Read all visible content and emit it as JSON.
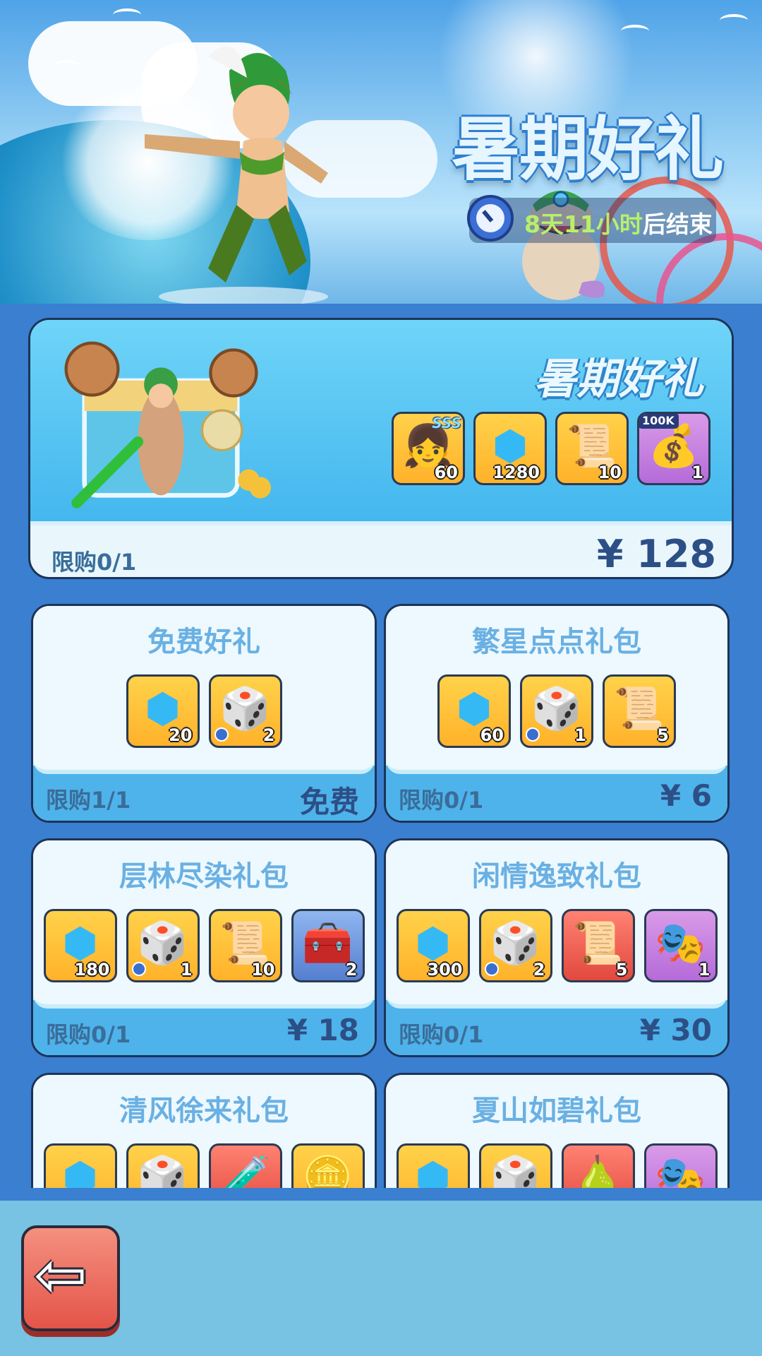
{
  "banner": {
    "title": "暑期好礼",
    "timer_highlight": "8天11小时",
    "timer_suffix": "后结束"
  },
  "featured": {
    "title": "暑期好礼",
    "limit": "限购0/1",
    "price": "¥ 128",
    "items": [
      {
        "icon": "hero-portrait-icon",
        "glyph": "👧",
        "badge": "SSS",
        "qty": "60",
        "bg": "gold"
      },
      {
        "icon": "gem-icon",
        "glyph": "⬢",
        "qty": "1280",
        "bg": "gold"
      },
      {
        "icon": "scroll-icon",
        "glyph": "📜",
        "qty": "10",
        "bg": "gold"
      },
      {
        "icon": "coin-bag-icon",
        "glyph": "💰",
        "tag": "100K",
        "qty": "1",
        "bg": "purple"
      }
    ]
  },
  "packs": [
    {
      "title": "免费好礼",
      "limit": "限购1/1",
      "price": "免费",
      "items": [
        {
          "icon": "gem-icon",
          "glyph": "⬢",
          "qty": "20",
          "bg": "gold"
        },
        {
          "icon": "dice-icon",
          "glyph": "🎲",
          "qty": "2",
          "bg": "gold",
          "timed": true
        }
      ]
    },
    {
      "title": "繁星点点礼包",
      "limit": "限购0/1",
      "price": "¥ 6",
      "items": [
        {
          "icon": "gem-icon",
          "glyph": "⬢",
          "qty": "60",
          "bg": "gold"
        },
        {
          "icon": "dice-icon",
          "glyph": "🎲",
          "qty": "1",
          "bg": "gold",
          "timed": true
        },
        {
          "icon": "scroll-icon",
          "glyph": "📜",
          "qty": "5",
          "bg": "gold"
        }
      ]
    },
    {
      "title": "层林尽染礼包",
      "limit": "限购0/1",
      "price": "¥ 18",
      "items": [
        {
          "icon": "gem-icon",
          "glyph": "⬢",
          "qty": "180",
          "bg": "gold"
        },
        {
          "icon": "dice-icon",
          "glyph": "🎲",
          "qty": "1",
          "bg": "gold",
          "timed": true
        },
        {
          "icon": "scroll-icon",
          "glyph": "📜",
          "qty": "10",
          "bg": "gold"
        },
        {
          "icon": "treasure-chest-icon",
          "glyph": "🧰",
          "qty": "2",
          "bg": "blue"
        }
      ]
    },
    {
      "title": "闲情逸致礼包",
      "limit": "限购0/1",
      "price": "¥ 30",
      "items": [
        {
          "icon": "gem-icon",
          "glyph": "⬢",
          "qty": "300",
          "bg": "gold"
        },
        {
          "icon": "dice-icon",
          "glyph": "🎲",
          "qty": "2",
          "bg": "gold",
          "timed": true
        },
        {
          "icon": "purple-scroll-icon",
          "glyph": "📜",
          "qty": "5",
          "bg": "red"
        },
        {
          "icon": "mask-chest-icon",
          "glyph": "🎭",
          "qty": "1",
          "bg": "purple"
        }
      ]
    },
    {
      "title": "清风徐来礼包",
      "limit": "",
      "price": "",
      "items": [
        {
          "icon": "gem-icon",
          "glyph": "⬢",
          "qty": "",
          "bg": "gold"
        },
        {
          "icon": "dice-icon",
          "glyph": "🎲",
          "qty": "",
          "bg": "gold"
        },
        {
          "icon": "potion-icon",
          "glyph": "🧪",
          "qty": "",
          "bg": "red"
        },
        {
          "icon": "coin-icon",
          "glyph": "🪙",
          "qty": "",
          "bg": "gold"
        }
      ]
    },
    {
      "title": "夏山如碧礼包",
      "limit": "",
      "price": "",
      "items": [
        {
          "icon": "gem-icon",
          "glyph": "⬢",
          "qty": "",
          "bg": "gold"
        },
        {
          "icon": "dice-icon",
          "glyph": "🎲",
          "qty": "",
          "bg": "gold"
        },
        {
          "icon": "bottle-icon",
          "glyph": "🍐",
          "qty": "",
          "bg": "red"
        },
        {
          "icon": "mask-chest-icon",
          "glyph": "🎭",
          "qty": "",
          "bg": "purple"
        }
      ]
    }
  ],
  "back_button": {
    "icon": "back-arrow-icon",
    "glyph": "⇦"
  }
}
